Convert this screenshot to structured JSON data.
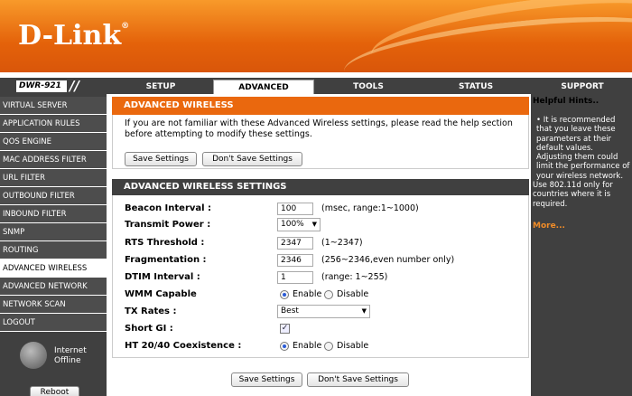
{
  "brand": {
    "logo": "D-Link",
    "tm": "®",
    "model": "DWR-921",
    "accent": "#ea680e"
  },
  "nav": {
    "tabs": [
      {
        "label": "SETUP"
      },
      {
        "label": "ADVANCED"
      },
      {
        "label": "TOOLS"
      },
      {
        "label": "STATUS"
      },
      {
        "label": "SUPPORT"
      }
    ],
    "active": "ADVANCED"
  },
  "sidebar": {
    "items": [
      {
        "label": "VIRTUAL SERVER"
      },
      {
        "label": "APPLICATION RULES"
      },
      {
        "label": "QOS ENGINE"
      },
      {
        "label": "MAC ADDRESS FILTER"
      },
      {
        "label": "URL FILTER"
      },
      {
        "label": "OUTBOUND FILTER"
      },
      {
        "label": "INBOUND FILTER"
      },
      {
        "label": "SNMP"
      },
      {
        "label": "ROUTING"
      },
      {
        "label": "ADVANCED WIRELESS"
      },
      {
        "label": "ADVANCED NETWORK"
      },
      {
        "label": "NETWORK SCAN"
      },
      {
        "label": "LOGOUT"
      }
    ],
    "active": "ADVANCED WIRELESS",
    "status_line1": "Internet",
    "status_line2": "Offline",
    "reboot_label": "Reboot"
  },
  "intro": {
    "title": "ADVANCED WIRELESS",
    "text": "If you are not familiar with these Advanced Wireless settings, please read the help section before attempting to modify these settings.",
    "save_label": "Save Settings",
    "dont_save_label": "Don't Save Settings"
  },
  "settings": {
    "title": "ADVANCED WIRELESS SETTINGS",
    "beacon": {
      "label": "Beacon Interval :",
      "value": "100",
      "hint": "(msec, range:1~1000)"
    },
    "power": {
      "label": "Transmit Power :",
      "value": "100%"
    },
    "rts": {
      "label": "RTS Threshold :",
      "value": "2347",
      "hint": "(1~2347)"
    },
    "frag": {
      "label": "Fragmentation :",
      "value": "2346",
      "hint": "(256~2346,even number only)"
    },
    "dtim": {
      "label": "DTIM Interval :",
      "value": "1",
      "hint": "(range: 1~255)"
    },
    "wmm": {
      "label": "WMM Capable",
      "enable": "Enable",
      "disable": "Disable",
      "selected": "Enable"
    },
    "txrates": {
      "label": "TX Rates :",
      "value": "Best"
    },
    "shortgi": {
      "label": "Short GI :",
      "checked": true,
      "mark": "✓"
    },
    "ht": {
      "label": "HT 20/40 Coexistence :",
      "enable": "Enable",
      "disable": "Disable",
      "selected": "Enable"
    }
  },
  "bottom": {
    "save_label": "Save Settings",
    "dont_save_label": "Don't Save Settings"
  },
  "hints": {
    "title": "Helpful Hints..",
    "bullet": "•",
    "text": "It is recommended that you leave these parameters at their default values. Adjusting them could limit the performance of your wireless network.",
    "text2": "Use 802.11d only for countries where it is required.",
    "more": "More..."
  }
}
